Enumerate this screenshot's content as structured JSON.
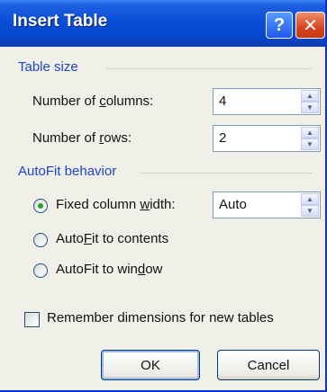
{
  "window": {
    "title": "Insert Table",
    "help_glyph": "?",
    "close_glyph": "✕"
  },
  "table_size": {
    "heading": "Table size",
    "columns": {
      "label_before": "Number of ",
      "label_access": "c",
      "label_after": "olumns:",
      "value": "4"
    },
    "rows": {
      "label_before": "Number of ",
      "label_access": "r",
      "label_after": "ows:",
      "value": "2"
    }
  },
  "autofit": {
    "heading": "AutoFit behavior",
    "fixed": {
      "label_before": "Fixed column ",
      "label_access": "w",
      "label_after": "idth:",
      "selected": true,
      "width_value": "Auto"
    },
    "contents": {
      "label_before": "Auto",
      "label_access": "F",
      "label_after": "it to contents",
      "selected": false
    },
    "window": {
      "label_before": "AutoFit to win",
      "label_access": "d",
      "label_after": "ow",
      "selected": false
    }
  },
  "remember": {
    "label": "Remember dimensions for new tables",
    "checked": false
  },
  "buttons": {
    "ok": "OK",
    "cancel": "Cancel"
  },
  "colors": {
    "titlebar": "#0a4fd8",
    "group_heading": "#1c46c8",
    "radio_dot": "#21a121",
    "dialog_bg": "#f0efe8"
  },
  "icons": {
    "help": "help-icon",
    "close": "close-icon",
    "spin_up": "spin-up-icon",
    "spin_down": "spin-down-icon"
  }
}
